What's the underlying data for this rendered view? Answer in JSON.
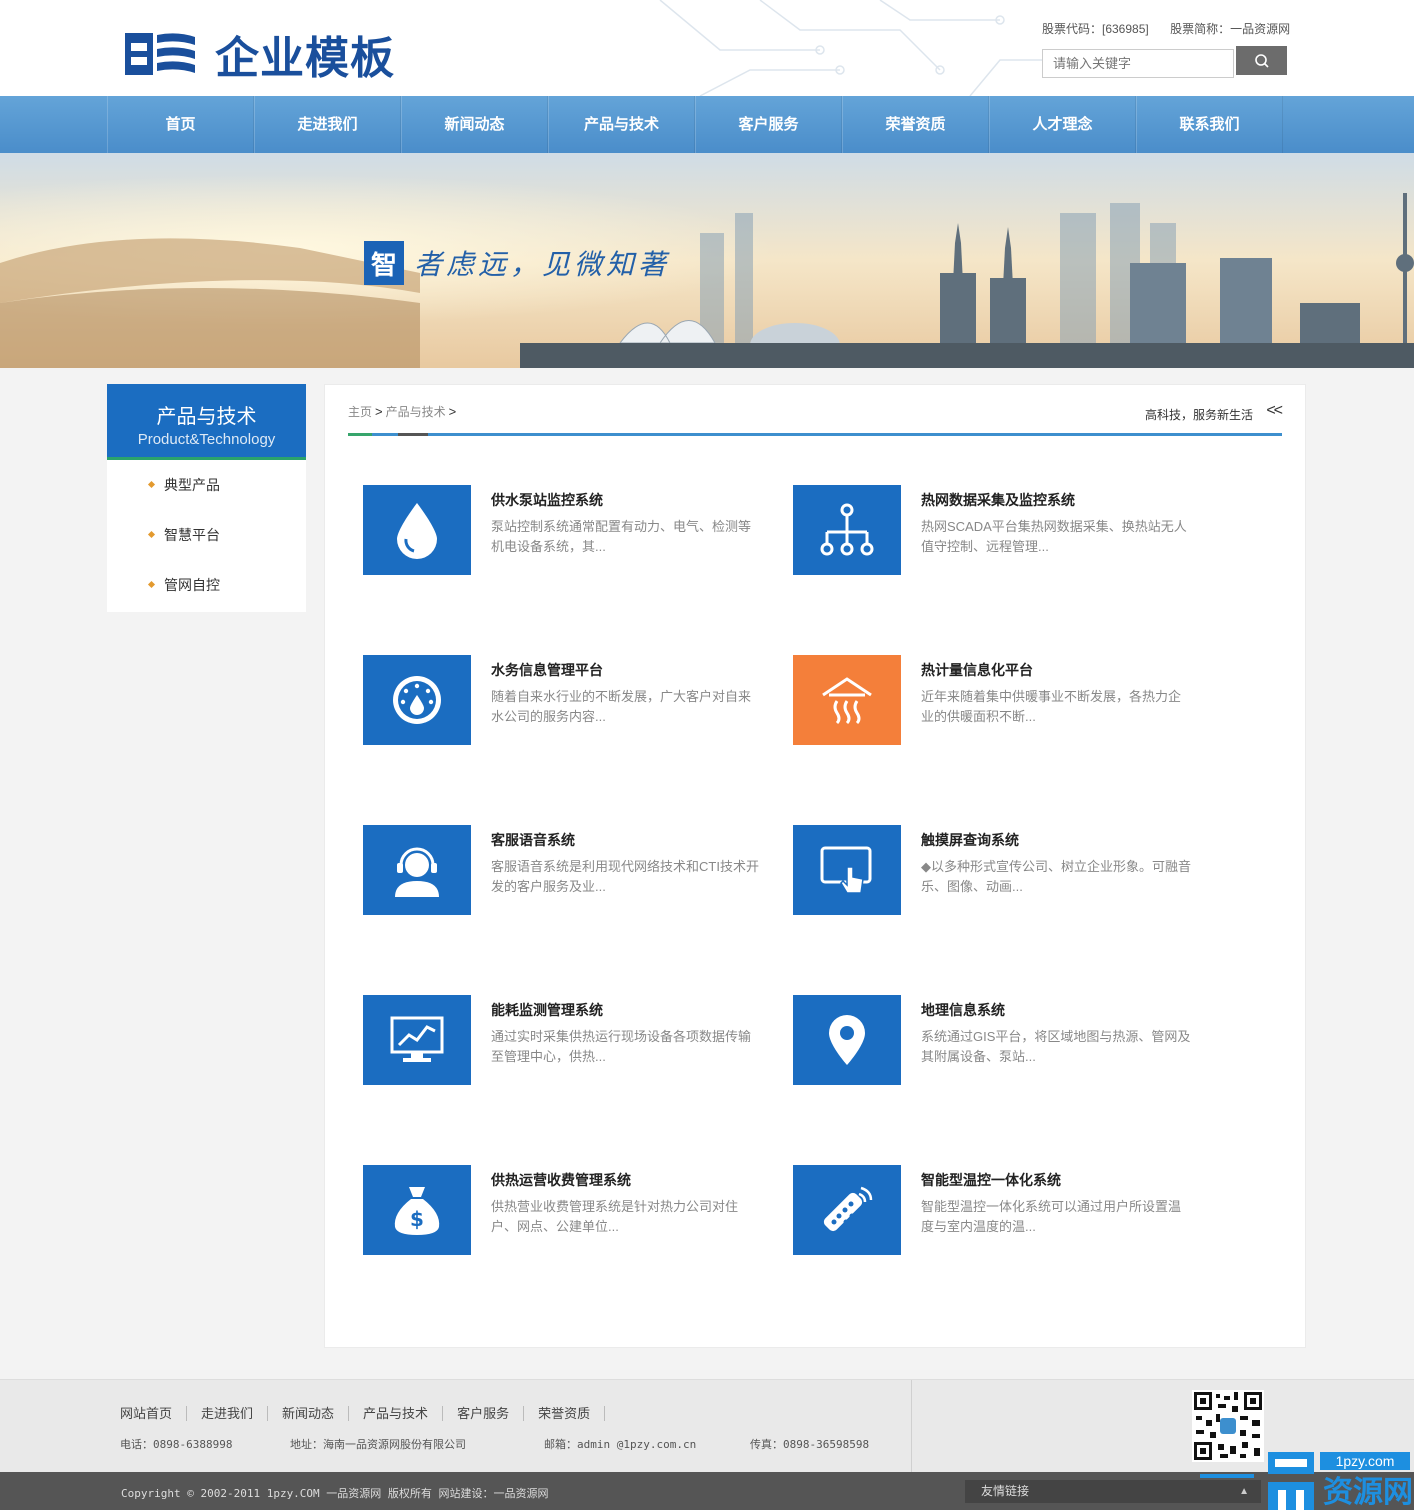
{
  "header": {
    "logo_text": "企业模板",
    "stock_code": "股票代码：[636985]",
    "stock_name": "股票简称：一品资源网",
    "search_placeholder": "请输入关键字"
  },
  "nav": [
    "首页",
    "走进我们",
    "新闻动态",
    "产品与技术",
    "客户服务",
    "荣誉资质",
    "人才理念",
    "联系我们"
  ],
  "banner": {
    "slogan_char": "智",
    "slogan_text": "者虑远，见微知著"
  },
  "sidebar": {
    "title": "产品与技术",
    "subtitle": "Product&Technology",
    "items": [
      "典型产品",
      "智慧平台",
      "管网自控"
    ]
  },
  "breadcrumb": {
    "home": "主页",
    "current": "产品与技术",
    "sep": ">"
  },
  "tagline": "高科技，服务新生活",
  "tag_arrow": "<<",
  "products": [
    {
      "icon": "water-drop-icon",
      "title": "供水泵站监控系统",
      "desc": "泵站控制系统通常配置有动力、电气、检测等机电设备系统，其..."
    },
    {
      "icon": "network-tree-icon",
      "title": "热网数据采集及监控系统",
      "desc": "热网SCADA平台集热网数据采集、换热站无人值守控制、远程管理..."
    },
    {
      "icon": "water-gauge-icon",
      "title": "水务信息管理平台",
      "desc": "随着自来水行业的不断发展，广大客户对自来水公司的服务内容..."
    },
    {
      "icon": "heating-icon",
      "title": "热计量信息化平台",
      "desc": "近年来随着集中供暖事业不断发展，各热力企业的供暖面积不断..."
    },
    {
      "icon": "customer-service-icon",
      "title": "客服语音系统",
      "desc": "客服语音系统是利用现代网络技术和CTI技术开发的客户服务及业..."
    },
    {
      "icon": "touch-screen-icon",
      "title": "触摸屏查询系统",
      "desc": "◆以多种形式宣传公司、树立企业形象。可融音乐、图像、动画..."
    },
    {
      "icon": "monitor-chart-icon",
      "title": "能耗监测管理系统",
      "desc": "通过实时采集供热运行现场设备各项数据传输至管理中心，供热..."
    },
    {
      "icon": "map-pin-icon",
      "title": "地理信息系统",
      "desc": "系统通过GIS平台，将区域地图与热源、管网及其附属设备、泵站..."
    },
    {
      "icon": "money-bag-icon",
      "title": "供热运营收费管理系统",
      "desc": "供热营业收费管理系统是针对热力公司对住户、网点、公建单位..."
    },
    {
      "icon": "remote-control-icon",
      "title": "智能型温控一体化系统",
      "desc": "智能型温控一体化系统可以通过用户所设置温度与室内温度的温..."
    }
  ],
  "footer": {
    "links": [
      "网站首页",
      "走进我们",
      "新闻动态",
      "产品与技术",
      "客户服务",
      "荣誉资质"
    ],
    "phone": "电话：0898-6388998",
    "address": "地址：海南一品资源网股份有限公司",
    "email": "邮箱：admin @1pzy.com.cn",
    "fax": "传真：0898-36598598",
    "copyright": "Copyright © 2002-2011 1pzy.COM 一品资源网 版权所有  网站建设：一品资源网",
    "friend_links": "友情链接",
    "watermark_url": "1pzy.com",
    "watermark_text": "资源网"
  },
  "colors": {
    "brand_blue": "#1b6dc1",
    "nav_blue": "#4a8dca",
    "accent_orange": "#f47f3a",
    "accent_green": "#37a56c"
  }
}
